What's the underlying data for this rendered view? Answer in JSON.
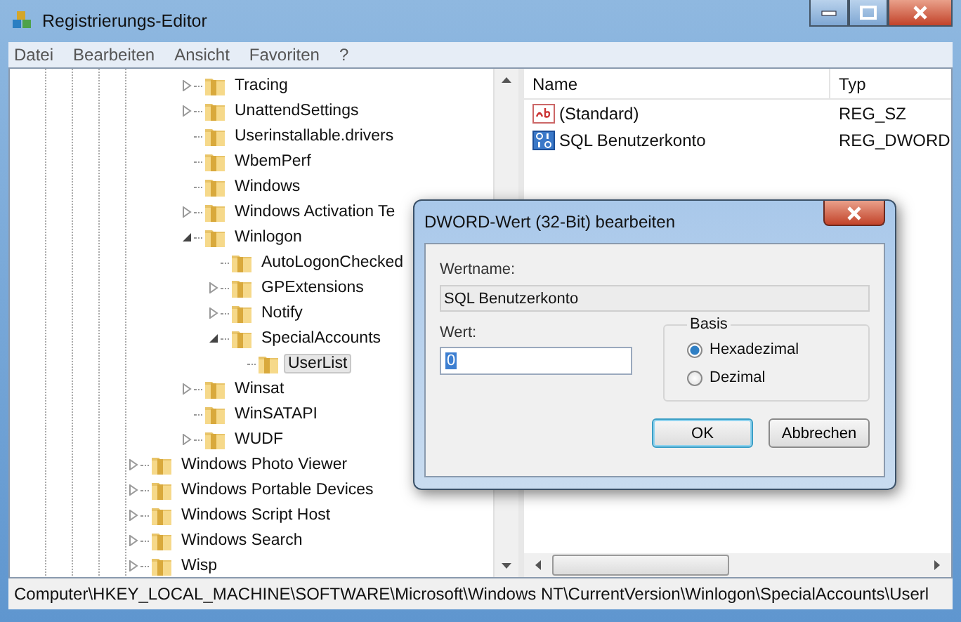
{
  "window": {
    "title": "Registrierungs-Editor"
  },
  "menu": [
    "Datei",
    "Bearbeiten",
    "Ansicht",
    "Favoriten",
    "?"
  ],
  "tree": {
    "scrolled_branch": [
      {
        "label": "Tracing",
        "expanded": false,
        "selected": false
      },
      {
        "label": "UnattendSettings",
        "expanded": false,
        "selected": false
      },
      {
        "label": "Userinstallable.drivers",
        "selected": false
      },
      {
        "label": "WbemPerf",
        "selected": false
      },
      {
        "label": "Windows",
        "selected": false
      },
      {
        "label": "Windows Activation Te",
        "expanded": false,
        "selected": false
      },
      {
        "label": "Winlogon",
        "expanded": true,
        "selected": false,
        "children": [
          {
            "label": "AutoLogonChecked",
            "selected": false
          },
          {
            "label": "GPExtensions",
            "expanded": false,
            "selected": false
          },
          {
            "label": "Notify",
            "expanded": false,
            "selected": false
          },
          {
            "label": "SpecialAccounts",
            "expanded": true,
            "selected": false,
            "children": [
              {
                "label": "UserList",
                "selected": true
              }
            ]
          }
        ]
      },
      {
        "label": "Winsat",
        "expanded": false,
        "selected": false
      },
      {
        "label": "WinSATAPI",
        "selected": false
      },
      {
        "label": "WUDF",
        "expanded": false,
        "selected": false
      }
    ],
    "items": [
      {
        "label": "Windows Photo Viewer",
        "expanded": false,
        "selected": false
      },
      {
        "label": "Windows Portable Devices",
        "expanded": false,
        "selected": false
      },
      {
        "label": "Windows Script Host",
        "expanded": false,
        "selected": false
      },
      {
        "label": "Windows Search",
        "expanded": false,
        "selected": false
      },
      {
        "label": "Wisp",
        "expanded": false,
        "selected": false
      }
    ]
  },
  "values_list": {
    "columns": [
      "Name",
      "Typ"
    ],
    "rows": [
      {
        "kind": "string",
        "name": "(Standard)",
        "type": "REG_SZ"
      },
      {
        "kind": "binary",
        "name": "SQL Benutzerkonto",
        "type": "REG_DWORD"
      }
    ]
  },
  "status_bar": "Computer\\HKEY_LOCAL_MACHINE\\SOFTWARE\\Microsoft\\Windows NT\\CurrentVersion\\Winlogon\\SpecialAccounts\\Userl",
  "dialog": {
    "title": "DWORD-Wert (32-Bit) bearbeiten",
    "name_label": "Wertname:",
    "name_value": "SQL Benutzerkonto",
    "value_label": "Wert:",
    "value": "0",
    "base_label": "Basis",
    "bases": [
      {
        "label": "Hexadezimal",
        "selected": true
      },
      {
        "label": "Dezimal",
        "selected": false
      }
    ],
    "buttons": [
      {
        "label": "OK",
        "default": true
      },
      {
        "label": "Abbrechen",
        "default": false
      }
    ]
  }
}
